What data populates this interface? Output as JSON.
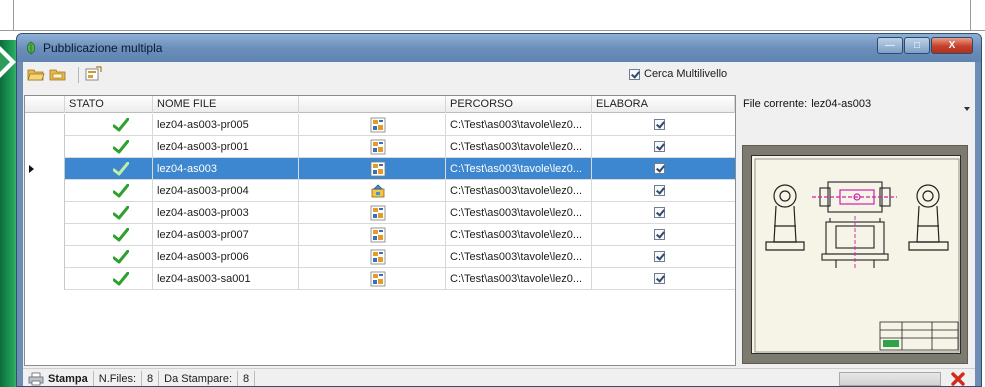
{
  "window": {
    "title": "Pubblicazione multipla",
    "controls": {
      "minimize": "—",
      "maximize": "□",
      "close": "X"
    }
  },
  "toolbar": {
    "icons": [
      "open-folder-icon",
      "folder-icon",
      "publish-icon"
    ],
    "multilevel_label": "Cerca Multilivello",
    "multilevel_checked": true
  },
  "grid": {
    "columns": [
      "STATO",
      "NOME FILE",
      "",
      "PERCORSO",
      "ELABORA"
    ],
    "rows": [
      {
        "status": "ok",
        "name": "lez04-as003-pr005",
        "icon": "part-icon",
        "path": "C:\\Test\\as003\\tavole\\lez0...",
        "elabora": true,
        "selected": false
      },
      {
        "status": "ok",
        "name": "lez04-as003-pr001",
        "icon": "part-icon",
        "path": "C:\\Test\\as003\\tavole\\lez0...",
        "elabora": true,
        "selected": false
      },
      {
        "status": "ok",
        "name": "lez04-as003",
        "icon": "part-icon",
        "path": "C:\\Test\\as003\\tavole\\lez0...",
        "elabora": true,
        "selected": true
      },
      {
        "status": "ok",
        "name": "lez04-as003-pr004",
        "icon": "assembly-icon",
        "path": "C:\\Test\\as003\\tavole\\lez0...",
        "elabora": true,
        "selected": false
      },
      {
        "status": "ok",
        "name": "lez04-as003-pr003",
        "icon": "part-icon",
        "path": "C:\\Test\\as003\\tavole\\lez0...",
        "elabora": true,
        "selected": false
      },
      {
        "status": "ok",
        "name": "lez04-as003-pr007",
        "icon": "part-icon",
        "path": "C:\\Test\\as003\\tavole\\lez0...",
        "elabora": true,
        "selected": false
      },
      {
        "status": "ok",
        "name": "lez04-as003-pr006",
        "icon": "part-icon",
        "path": "C:\\Test\\as003\\tavole\\lez0...",
        "elabora": true,
        "selected": false
      },
      {
        "status": "ok",
        "name": "lez04-as003-sa001",
        "icon": "part-icon",
        "path": "C:\\Test\\as003\\tavole\\lez0...",
        "elabora": true,
        "selected": false
      }
    ]
  },
  "preview": {
    "label": "File corrente:",
    "current_file": "lez04-as003"
  },
  "statusbar": {
    "print_label": "Stampa",
    "nfiles_label": "N.Files:",
    "nfiles_value": "8",
    "to_print_label": "Da Stampare:",
    "to_print_value": "8"
  },
  "colors": {
    "titlebar": "#6b8fba",
    "selection": "#3d86d0",
    "check_green": "#2ea02e",
    "stop_red": "#d42a1a"
  }
}
